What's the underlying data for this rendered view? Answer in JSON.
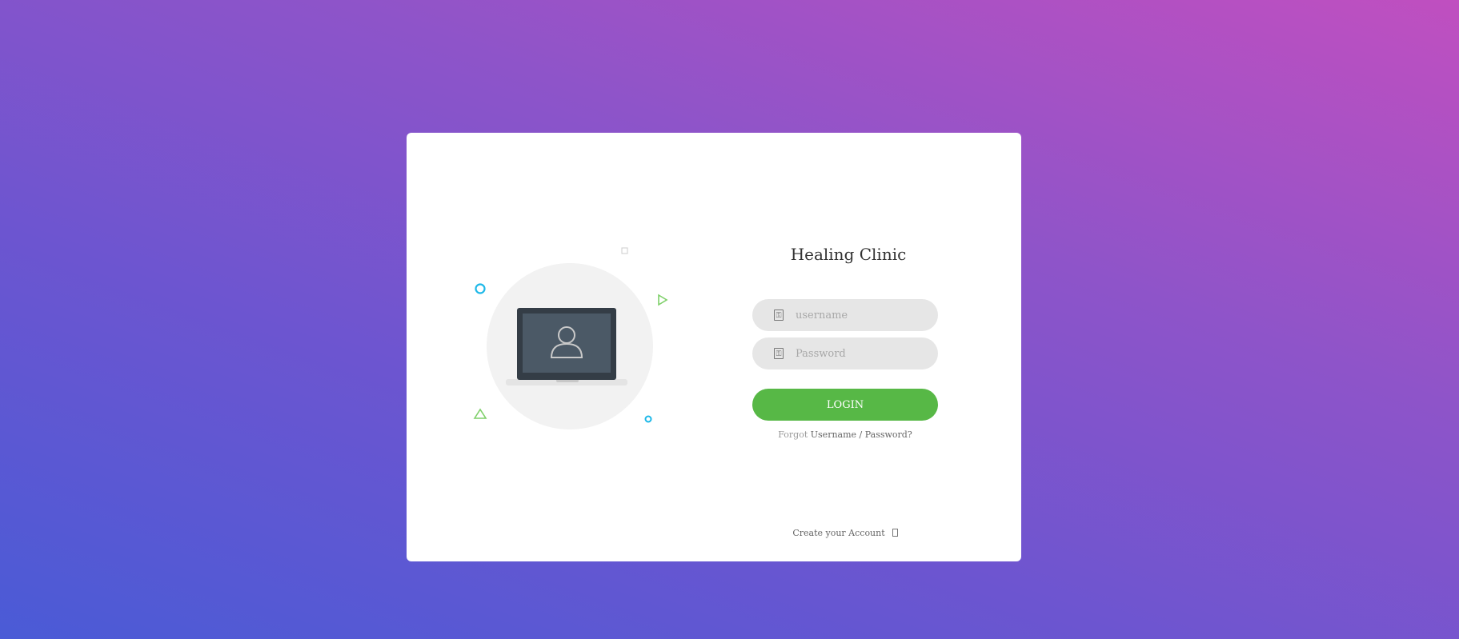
{
  "form": {
    "title": "Healing Clinic",
    "username_placeholder": "username",
    "username_value": "",
    "password_placeholder": "Password",
    "password_value": "",
    "login_label": "LOGIN",
    "forgot_prefix": "Forgot",
    "forgot_link": "Username / Password?",
    "create_account": "Create your Account"
  },
  "icons": {
    "username": "user-icon",
    "password": "lock-icon",
    "create_account": "arrow-right-icon",
    "illustration": "laptop-user-illustration"
  },
  "colors": {
    "accent_green": "#57b846",
    "accent_cyan": "#1eb8e8",
    "field_bg": "#e6e6e6",
    "gradient_start": "#4a5bd6",
    "gradient_end": "#c04fc0"
  }
}
